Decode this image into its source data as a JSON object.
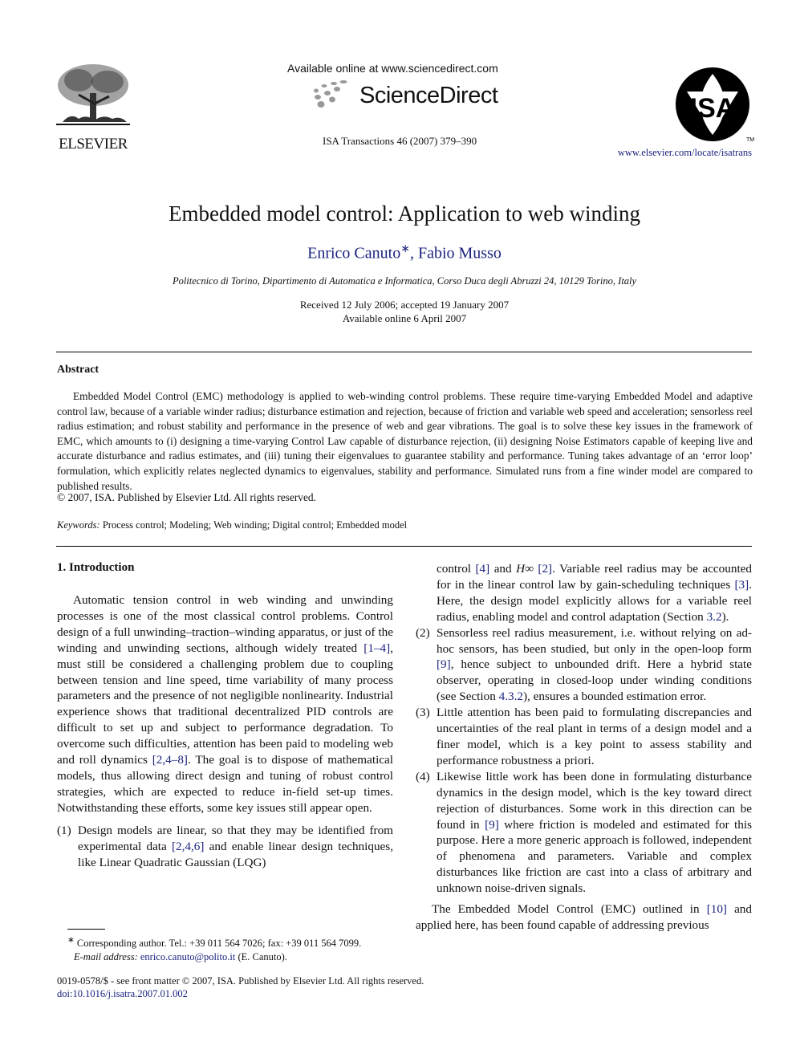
{
  "header": {
    "publisher": "ELSEVIER",
    "available_online": "Available online at www.sciencedirect.com",
    "sciencedirect": "ScienceDirect",
    "journal": "ISA Transactions 46 (2007) 379–390",
    "isa_logo_text": "ISA",
    "isa_tm": "TM",
    "journal_url": "www.elsevier.com/locate/isatrans"
  },
  "article": {
    "title": "Embedded model control: Application to web winding",
    "authors": [
      {
        "name": "Enrico Canuto",
        "mark": "∗"
      },
      {
        "name": "Fabio Musso"
      }
    ],
    "author_sep": ", ",
    "affiliation": "Politecnico di Torino, Dipartimento di Automatica e Informatica, Corso Duca degli Abruzzi 24, 10129 Torino, Italy",
    "received": "Received 12 July 2006; accepted 19 January 2007",
    "available": "Available online 6 April 2007"
  },
  "abstract": {
    "heading": "Abstract",
    "text": "Embedded Model Control (EMC) methodology is applied to web-winding control problems. These require time-varying Embedded Model and adaptive control law, because of a variable winder radius; disturbance estimation and rejection, because of friction and variable web speed and acceleration; sensorless reel radius estimation; and robust stability and performance in the presence of web and gear vibrations. The goal is to solve these key issues in the framework of EMC, which amounts to (i) designing a time-varying Control Law capable of disturbance rejection, (ii) designing Noise Estimators capable of keeping live and accurate disturbance and radius estimates, and (iii) tuning their eigenvalues to guarantee stability and performance. Tuning takes advantage of an ‘error loop’ formulation, which explicitly relates neglected dynamics to eigenvalues, stability and performance. Simulated runs from a fine winder model are compared to published results.",
    "copyright": "© 2007, ISA. Published by Elsevier Ltd. All rights reserved.",
    "keywords_label": "Keywords:",
    "keywords": "Process control; Modeling; Web winding; Digital control; Embedded model"
  },
  "intro": {
    "heading": "1.  Introduction",
    "p1_a": "Automatic tension control in web winding and unwinding processes is one of the most classical control problems. Control design of a full unwinding–traction–winding apparatus, or just of the winding and unwinding sections, although widely treated ",
    "p1_ref1": "[1–4]",
    "p1_b": ", must still be considered a challenging problem due to coupling between tension and line speed, time variability of many process parameters and the presence of not negligible nonlinearity. Industrial experience shows that traditional decentralized PID controls are difficult to set up and subject to performance degradation. To overcome such difficulties, attention has been paid to modeling web and roll dynamics ",
    "p1_ref2": "[2,4–8]",
    "p1_c": ". The goal is to dispose of mathematical models, thus allowing direct design and tuning of robust control strategies, which are expected to reduce in-field set-up times. Notwithstanding these efforts, some key issues still appear open.",
    "item1_num": "(1)",
    "item1_a": "Design models are linear, so that they may be identified from experimental data ",
    "item1_ref1": "[2,4,6]",
    "item1_b": " and enable linear design techniques, like Linear Quadratic Gaussian (LQG)",
    "item1_c": "control ",
    "item1_ref2": "[4]",
    "item1_d": " and ",
    "item1_hinf": "H∞",
    "item1_e": " ",
    "item1_ref3": "[2]",
    "item1_f": ". Variable reel radius may be accounted for in the linear control law by gain-scheduling techniques ",
    "item1_ref4": "[3]",
    "item1_g": ". Here, the design model explicitly allows for a variable reel radius, enabling model and control adaptation (Section ",
    "item1_ref5": "3.2",
    "item1_h": ").",
    "item2_num": "(2)",
    "item2_a": "Sensorless reel radius measurement, i.e. without relying on ad-hoc sensors, has been studied, but only in the open-loop form ",
    "item2_ref1": "[9]",
    "item2_b": ", hence subject to unbounded drift. Here a hybrid state observer, operating in closed-loop under winding conditions (see Section ",
    "item2_ref2": "4.3.2",
    "item2_c": "), ensures a bounded estimation error.",
    "item3_num": "(3)",
    "item3": "Little attention has been paid to formulating discrepancies and uncertainties of the real plant in terms of a design model and a finer model, which is a key point to assess stability and performance robustness a priori.",
    "item4_num": "(4)",
    "item4_a": "Likewise little work has been done in formulating disturbance dynamics in the design model, which is the key toward direct rejection of disturbances. Some work in this direction can be found in ",
    "item4_ref1": "[9]",
    "item4_b": " where friction is modeled and estimated for this purpose. Here a more generic approach is followed, independent of phenomena and parameters. Variable and complex disturbances like friction are cast into a class of arbitrary and unknown noise-driven signals.",
    "p2_a": "The Embedded Model Control (EMC) outlined in ",
    "p2_ref": "[10]",
    "p2_b": " and applied here, has been found capable of addressing previous"
  },
  "footnote": {
    "mark": "∗",
    "line1": " Corresponding author. Tel.: +39 011 564 7026; fax: +39 011 564 7099.",
    "email_label": "E-mail address:",
    "email": "enrico.canuto@polito.it",
    "email_suffix": " (E. Canuto)."
  },
  "bottom": {
    "issn": "0019-0578/$ - see front matter © 2007, ISA. Published by Elsevier Ltd. All rights reserved.",
    "doi": "doi:10.1016/j.isatra.2007.01.002"
  }
}
